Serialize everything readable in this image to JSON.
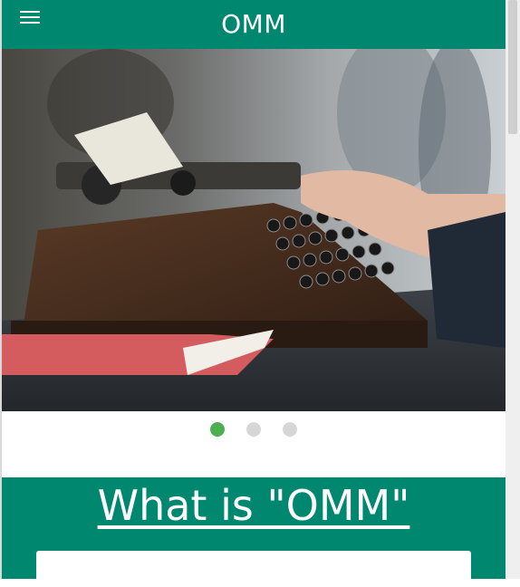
{
  "header": {
    "title": "OMM"
  },
  "carousel": {
    "slides": 3,
    "active_index": 0
  },
  "section": {
    "title": "What is \"OMM\""
  },
  "colors": {
    "primary": "#00876f",
    "dot_active": "#4caf50",
    "dot_inactive": "#d6d6d6"
  }
}
